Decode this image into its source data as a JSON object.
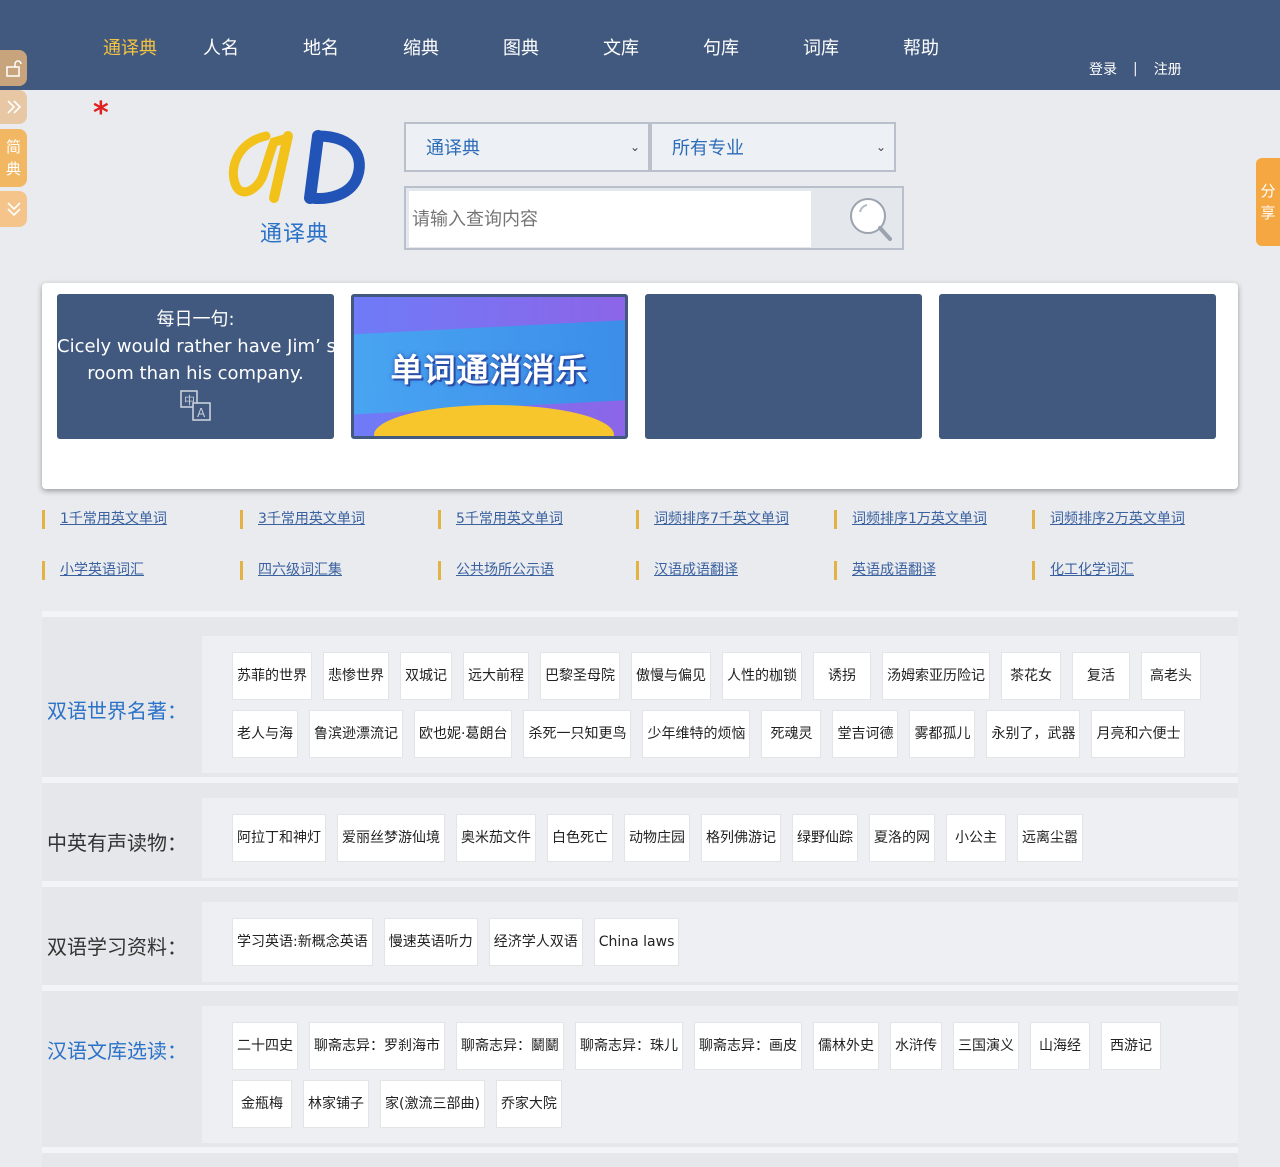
{
  "nav": {
    "items": [
      "通译典",
      "人名",
      "地名",
      "缩典",
      "图典",
      "文库",
      "句库",
      "词库",
      "帮助"
    ],
    "active_index": 0,
    "login": "登录",
    "separator": "|",
    "register": "注册"
  },
  "left_tabs": {
    "simple_top": "简",
    "simple_bottom": "典"
  },
  "share_tab": {
    "top": "分",
    "bottom": "享"
  },
  "logo": {
    "text": "通译典"
  },
  "search": {
    "select1": "通译典",
    "select2": "所有专业",
    "placeholder": "请输入查询内容"
  },
  "daily": {
    "title": "每日一句:",
    "sentence_line1": "Cicely would rather have Jim’ s",
    "sentence_line2": "room than his company."
  },
  "banner": {
    "text": "单词通消消乐"
  },
  "links_row1": [
    "1千常用英文单词",
    "3千常用英文单词",
    "5千常用英文单词",
    "词频排序7千英文单词",
    "词频排序1万英文单词",
    "词频排序2万英文单词"
  ],
  "links_row2": [
    "小学英语词汇",
    "四六级词汇集",
    "公共场所公示语",
    "汉语成语翻译",
    "英语成语翻译",
    "化工化学词汇"
  ],
  "sections": [
    {
      "label": "双语世界名著：",
      "tags": [
        "苏菲的世界",
        "悲惨世界",
        "双城记",
        "远大前程",
        "巴黎圣母院",
        "傲慢与偏见",
        "人性的枷锁",
        "诱拐",
        "汤姆索亚历险记",
        "茶花女",
        "复活",
        "高老头",
        "老人与海",
        "鲁滨逊漂流记",
        "欧也妮·葛朗台",
        "杀死一只知更鸟",
        "少年维特的烦恼",
        "死魂灵",
        "堂吉诃德",
        "雾都孤儿",
        "永别了，武器",
        "月亮和六便士"
      ]
    },
    {
      "label": "中英有声读物：",
      "tags": [
        "阿拉丁和神灯",
        "爱丽丝梦游仙境",
        "奥米茄文件",
        "白色死亡",
        "动物庄园",
        "格列佛游记",
        "绿野仙踪",
        "夏洛的网",
        "小公主",
        "远离尘嚣"
      ]
    },
    {
      "label": "双语学习资料：",
      "tags": [
        "学习英语:新概念英语",
        "慢速英语听力",
        "经济学人双语",
        "China laws"
      ]
    },
    {
      "label": "汉语文库选读：",
      "tags": [
        "二十四史",
        "聊斋志异：罗刹海市",
        "聊斋志异：鬭鬭",
        "聊斋志异：珠儿",
        "聊斋志异：画皮",
        "儒林外史",
        "水浒传",
        "三国演义",
        "山海经",
        "西游记",
        "金瓶梅",
        "林家铺子",
        "家(激流三部曲)",
        "乔家大院"
      ]
    }
  ],
  "colors": {
    "nav_bg": "#41597e",
    "active": "#f5c242",
    "accent_blue": "#2b72c9",
    "link_bar": "#e3b245"
  }
}
